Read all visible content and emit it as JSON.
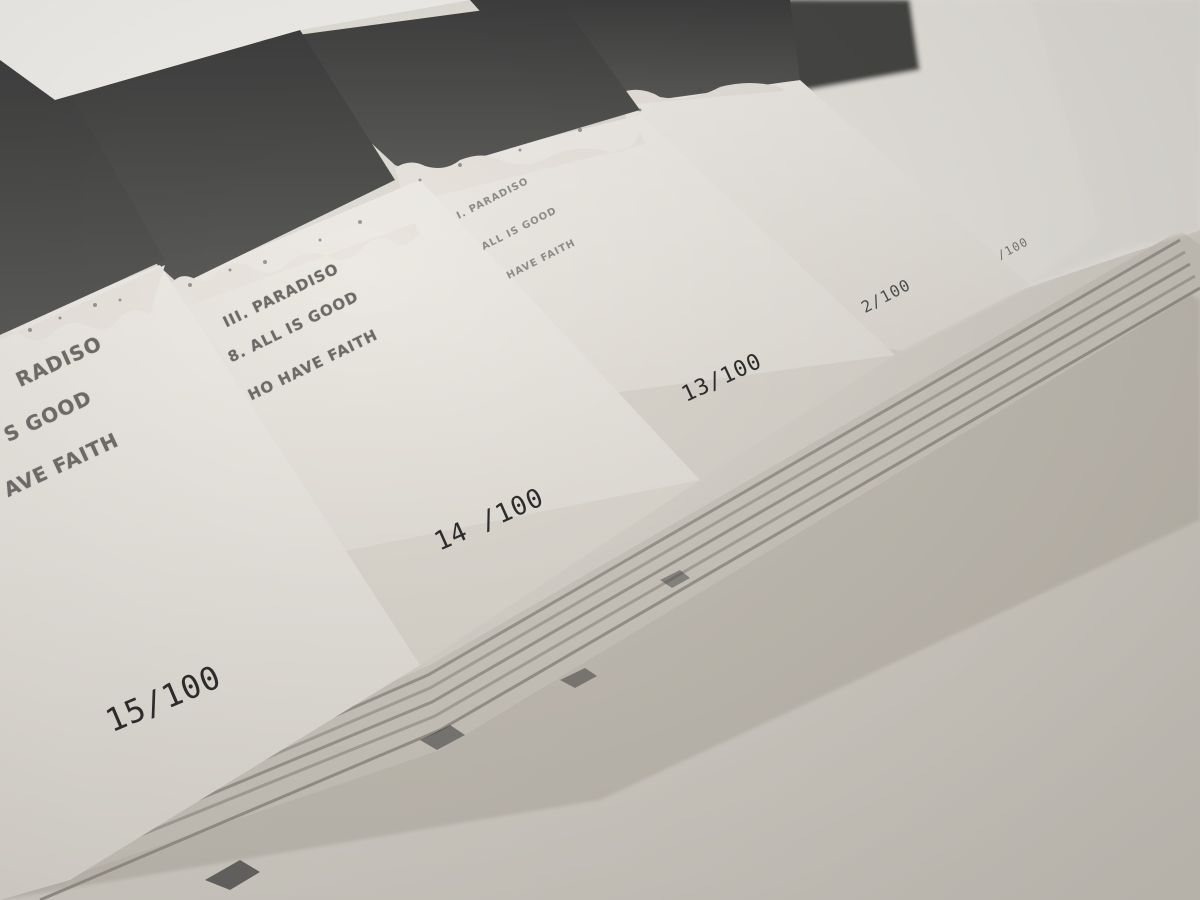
{
  "photo": {
    "subject": "stacked letterpress inserts with hand-numbered editions",
    "colors": {
      "background": "#d9d5cd",
      "card": "#e9e6e0",
      "card_shadow": "#bdb8ae",
      "ink_dark": "#4a4a4a",
      "ink_text": "#6b6a66",
      "pencil": "#2c2c2c"
    }
  },
  "cards": [
    {
      "tracks": [
        "RADISO",
        "S GOOD",
        "AVE FAITH"
      ],
      "edition": "15/100"
    },
    {
      "tracks": [
        "III. PARADISO",
        "8. ALL IS GOOD",
        "HO HAVE FAITH"
      ],
      "edition": "14 /100"
    },
    {
      "tracks": [
        "I. PARADISO",
        "ALL IS GOOD",
        "HAVE FAITH"
      ],
      "edition": "13/100"
    },
    {
      "tracks": [],
      "edition": "2/100"
    },
    {
      "tracks": [],
      "edition": "/100"
    }
  ]
}
